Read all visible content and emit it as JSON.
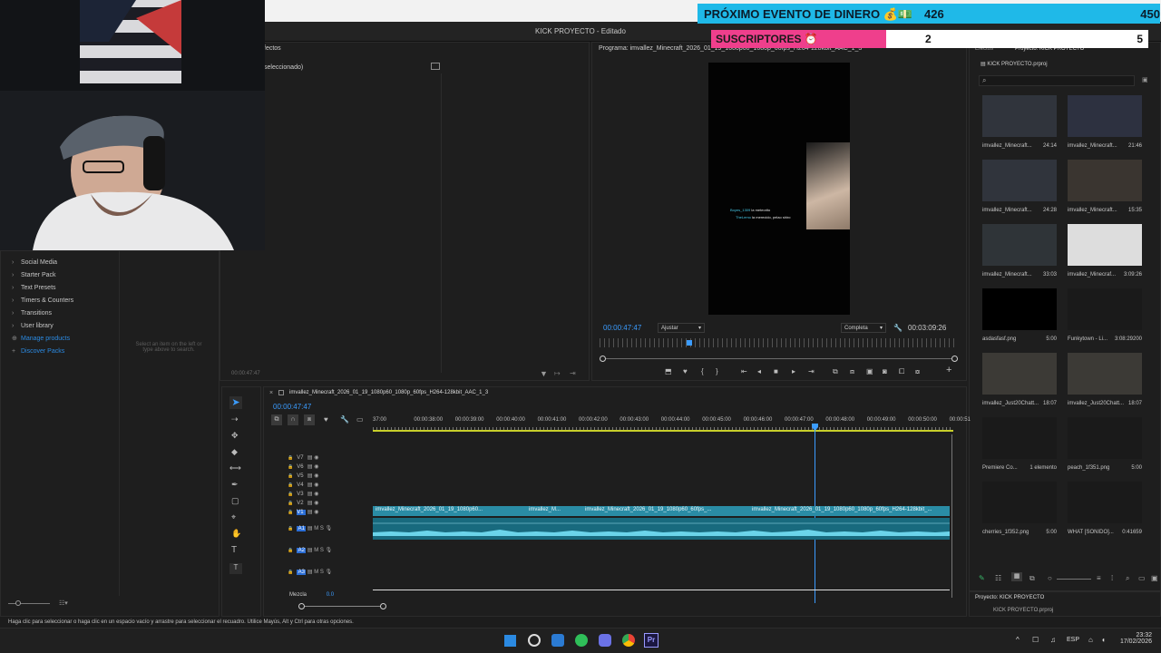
{
  "app": {
    "title": "KICK PROYECTO - Editado"
  },
  "overlays": {
    "event_label": "PRÓXIMO EVENTO DE DINERO 💰💵",
    "event_current": "426",
    "event_goal": "450",
    "subs_label": "SUSCRIPTORES ⏰",
    "subs_current": "2",
    "subs_goal": "5",
    "event_progress": 0.95,
    "subs_progress": 0.4
  },
  "effects_panel": {
    "title": "fectos",
    "subtitle": "seleccionado)",
    "timecode": "00:00:47:47",
    "hint": "Select an item on the left or type above to search."
  },
  "library": {
    "items": [
      {
        "label": "Social Media",
        "arrow": "›"
      },
      {
        "label": "Starter Pack",
        "arrow": "›"
      },
      {
        "label": "Text Presets",
        "arrow": "›"
      },
      {
        "label": "Timers & Counters",
        "arrow": "›"
      },
      {
        "label": "Transitions",
        "arrow": "›"
      },
      {
        "label": "User library",
        "arrow": "›"
      },
      {
        "label": "Manage products",
        "arrow": "⊕"
      },
      {
        "label": "Discover Packs",
        "arrow": "+"
      }
    ]
  },
  "program": {
    "title": "Programa: imvallez_Minecraft_2026_01_19_1080p60_1080p_60fps_H264-128kbit_AAC_1_3",
    "timecode": "00:00:47:47",
    "fit": "Ajustar",
    "quality": "Completa",
    "duration": "00:03:09:26",
    "chat_line1_user": "Boyes_1309",
    "chat_line1_text": "la meteorito",
    "chat_line2_user": "TheLemo",
    "chat_line2_text": "la merecido, pelao shiro"
  },
  "project": {
    "tab_effects": "Efectos",
    "tab_project": "Proyecto: KICK PROYECTO",
    "file": "KICK PROYECTO.prproj",
    "items": [
      {
        "name": "imvallez_Minecraft...",
        "dur": "24:14"
      },
      {
        "name": "imvallez_Minecraft...",
        "dur": "21:46"
      },
      {
        "name": "imvallez_Minecraft...",
        "dur": "24:28"
      },
      {
        "name": "imvallez_Minecraft...",
        "dur": "15:35"
      },
      {
        "name": "imvallez_Minecraft...",
        "dur": "33:03"
      },
      {
        "name": "imvallez_Minecraf...",
        "dur": "3:09:26"
      },
      {
        "name": "asdasfasf.png",
        "dur": "5:00"
      },
      {
        "name": "Funkytown - Li...",
        "dur": "3:08:29200"
      },
      {
        "name": "imvallez_Just20Chatt...",
        "dur": "18:07"
      },
      {
        "name": "imvallez_Just20Chatt...",
        "dur": "18:07"
      },
      {
        "name": "Premiere Co...",
        "dur": "1 elemento"
      },
      {
        "name": "peach_1f351.png",
        "dur": "5:00"
      },
      {
        "name": "cherries_1f352.png",
        "dur": "5:00"
      },
      {
        "name": "WHAT [SONIDO]...",
        "dur": "0:41659"
      }
    ],
    "bottom_title": "Proyecto: KICK PROYECTO",
    "bottom_file": "KICK PROYECTO.prproj"
  },
  "timeline": {
    "sequence": "imvallez_Minecraft_2026_01_19_1080p60_1080p_60fps_H264-128kbit_AAC_1_3",
    "timecode": "00:00:47:47",
    "ticks": [
      "37:00",
      "00:00:38:00",
      "00:00:39:00",
      "00:00:40:00",
      "00:00:41:00",
      "00:00:42:00",
      "00:00:43:00",
      "00:00:44:00",
      "00:00:45:00",
      "00:00:46:00",
      "00:00:47:00",
      "00:00:48:00",
      "00:00:49:00",
      "00:00:50:00",
      "00:00:51"
    ],
    "video_tracks": [
      "V7",
      "V6",
      "V5",
      "V4",
      "V3",
      "V2",
      "V1"
    ],
    "audio_tracks": [
      "A1",
      "A2",
      "A3"
    ],
    "mix_label": "Mezcla",
    "mix_value": "0.0",
    "clip1": "imvallez_Minecraft_2026_01_19_1080p60...",
    "clip2": "imvallez_M...",
    "clip3": "imvallez_Minecraft_2026_01_19_1080p60_60fps_...",
    "clip4": "imvallez_Minecraft_2026_01_19_1080p60_1080p_60fps_H264-128kbit_..."
  },
  "status_bar": {
    "text": "Haga clic para seleccionar o haga clic en un espacio vacío y arrastre para seleccionar el recuadro. Utilice Mayús, Alt y Ctrl para otras opciones."
  },
  "taskbar": {
    "lang": "ESP",
    "time": "23:32",
    "date": "17/02/2026"
  }
}
